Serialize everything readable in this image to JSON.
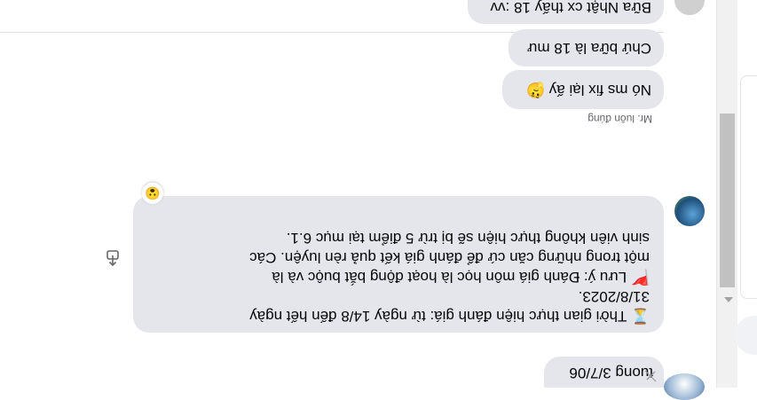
{
  "messages": [
    {
      "id": "top",
      "text": "tuong 3/7/06"
    },
    {
      "id": "main",
      "lines": [
        "⌛ Thời gian thực hiện đánh giá: từ ngày 14/8 đến hết ngày",
        "31/8/2023.",
        "🚩 Lưu ý: Đánh giá môn học là hoạt động bắt buộc và là",
        "một trong những căn cứ để đánh giá kết quả rèn luyện. Các",
        "sinh viên không thực hiện sẽ bị trừ 5 điểm tại mục 6.1."
      ],
      "reaction": "😮"
    },
    {
      "id": "sender",
      "text": "Mr. luôn đúng"
    },
    {
      "id": "m1",
      "text": "Nó ms fix lại ấy 🤔"
    },
    {
      "id": "m2",
      "text": "Chứ bữa là 18 mư"
    },
    {
      "id": "m3",
      "text": "Bữa Nhật cx thấy 18 :vv"
    }
  ],
  "icons": {
    "forward": "forward-icon",
    "edited": "pencil-icon",
    "scroll": "scroll-arrow-icon"
  },
  "colors": {
    "bubble": "#e4e6eb",
    "text": "#050505",
    "meta": "#65676b"
  }
}
